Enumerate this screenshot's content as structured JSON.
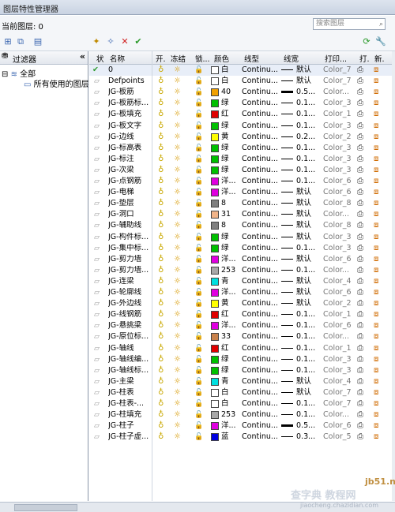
{
  "window": {
    "title": "图层特性管理器"
  },
  "current_layer": "当前图层: 0",
  "search": {
    "placeholder": "搜索图层"
  },
  "filter_tree": {
    "header": "过滤器",
    "collapse": "«",
    "nodes": [
      "全部",
      "所有使用的图层"
    ]
  },
  "columns": [
    "状",
    "名称",
    "开.",
    "冻结",
    "锁...",
    "颜色",
    "线型",
    "线宽",
    "打印...",
    "打.",
    "新."
  ],
  "rows": [
    {
      "name": "0",
      "color": "#ffffff",
      "cname": "白",
      "linetype": "Continu...",
      "lw": "默认",
      "thick": false,
      "plot": "Color_7",
      "current": true
    },
    {
      "name": "Defpoints",
      "color": "#ffffff",
      "cname": "白",
      "linetype": "Continu...",
      "lw": "默认",
      "thick": false,
      "plot": "Color_7"
    },
    {
      "name": "JG-板筋",
      "color": "#f0a000",
      "cname": "40",
      "linetype": "Continu...",
      "lw": "0.5...",
      "thick": true,
      "plot": "Color..."
    },
    {
      "name": "JG-板筋标...",
      "color": "#00c000",
      "cname": "绿",
      "linetype": "Continu...",
      "lw": "0.1...",
      "thick": false,
      "plot": "Color_3"
    },
    {
      "name": "JG-板填充",
      "color": "#e00000",
      "cname": "红",
      "linetype": "Continu...",
      "lw": "0.1...",
      "thick": false,
      "plot": "Color_1"
    },
    {
      "name": "JG-板文字",
      "color": "#00c000",
      "cname": "绿",
      "linetype": "Continu...",
      "lw": "0.1...",
      "thick": false,
      "plot": "Color_3"
    },
    {
      "name": "JG-边线",
      "color": "#ffff00",
      "cname": "黄",
      "linetype": "Continu...",
      "lw": "0.2...",
      "thick": false,
      "plot": "Color_2"
    },
    {
      "name": "JG-标高表",
      "color": "#00c000",
      "cname": "绿",
      "linetype": "Continu...",
      "lw": "0.1...",
      "thick": false,
      "plot": "Color_3"
    },
    {
      "name": "JG-标注",
      "color": "#00c000",
      "cname": "绿",
      "linetype": "Continu...",
      "lw": "0.1...",
      "thick": false,
      "plot": "Color_3"
    },
    {
      "name": "JG-次梁",
      "color": "#00c000",
      "cname": "绿",
      "linetype": "Continu...",
      "lw": "0.1...",
      "thick": false,
      "plot": "Color_3"
    },
    {
      "name": "JG-点钢筋",
      "color": "#e000e0",
      "cname": "洋...",
      "linetype": "Continu...",
      "lw": "0.1...",
      "thick": false,
      "plot": "Color_6"
    },
    {
      "name": "JG-电梯",
      "color": "#e000e0",
      "cname": "洋...",
      "linetype": "Continu...",
      "lw": "默认",
      "thick": false,
      "plot": "Color_6"
    },
    {
      "name": "JG-垫层",
      "color": "#808080",
      "cname": "8",
      "linetype": "Continu...",
      "lw": "默认",
      "thick": false,
      "plot": "Color_8"
    },
    {
      "name": "JG-洞口",
      "color": "#f2b58a",
      "cname": "31",
      "linetype": "Continu...",
      "lw": "默认",
      "thick": false,
      "plot": "Color..."
    },
    {
      "name": "JG-辅助线",
      "color": "#808080",
      "cname": "8",
      "linetype": "Continu...",
      "lw": "默认",
      "thick": false,
      "plot": "Color_8"
    },
    {
      "name": "JG-构件标...",
      "color": "#00c000",
      "cname": "绿",
      "linetype": "Continu...",
      "lw": "默认",
      "thick": false,
      "plot": "Color_3"
    },
    {
      "name": "JG-集中标...",
      "color": "#00c000",
      "cname": "绿",
      "linetype": "Continu...",
      "lw": "0.1...",
      "thick": false,
      "plot": "Color_3"
    },
    {
      "name": "JG-剪力墙",
      "color": "#e000e0",
      "cname": "洋...",
      "linetype": "Continu...",
      "lw": "默认",
      "thick": false,
      "plot": "Color_6"
    },
    {
      "name": "JG-剪力墙...",
      "color": "#a8a8a8",
      "cname": "253",
      "linetype": "Continu...",
      "lw": "0.1...",
      "thick": false,
      "plot": "Color..."
    },
    {
      "name": "JG-连梁",
      "color": "#00e0e0",
      "cname": "青",
      "linetype": "Continu...",
      "lw": "默认",
      "thick": false,
      "plot": "Color_4"
    },
    {
      "name": "JG-轮廓线",
      "color": "#e000e0",
      "cname": "洋...",
      "linetype": "Continu...",
      "lw": "默认",
      "thick": false,
      "plot": "Color_6"
    },
    {
      "name": "JG-外边线",
      "color": "#ffff00",
      "cname": "黄",
      "linetype": "Continu...",
      "lw": "默认",
      "thick": false,
      "plot": "Color_2"
    },
    {
      "name": "JG-线钢筋",
      "color": "#e00000",
      "cname": "红",
      "linetype": "Continu...",
      "lw": "0.1...",
      "thick": false,
      "plot": "Color_1"
    },
    {
      "name": "JG-悬挑梁",
      "color": "#e000e0",
      "cname": "洋...",
      "linetype": "Continu...",
      "lw": "0.1...",
      "thick": false,
      "plot": "Color_6"
    },
    {
      "name": "JG-原位标...",
      "color": "#c9824c",
      "cname": "33",
      "linetype": "Continu...",
      "lw": "0.1...",
      "thick": false,
      "plot": "Color..."
    },
    {
      "name": "JG-轴线",
      "color": "#e00000",
      "cname": "红",
      "linetype": "Continu...",
      "lw": "0.1...",
      "thick": false,
      "plot": "Color_1"
    },
    {
      "name": "JG-轴线编...",
      "color": "#00c000",
      "cname": "绿",
      "linetype": "Continu...",
      "lw": "0.1...",
      "thick": false,
      "plot": "Color_3"
    },
    {
      "name": "JG-轴线标...",
      "color": "#00c000",
      "cname": "绿",
      "linetype": "Continu...",
      "lw": "0.1...",
      "thick": false,
      "plot": "Color_3"
    },
    {
      "name": "JG-主梁",
      "color": "#00e0e0",
      "cname": "青",
      "linetype": "Continu...",
      "lw": "默认",
      "thick": false,
      "plot": "Color_4"
    },
    {
      "name": "JG-柱表",
      "color": "#ffffff",
      "cname": "白",
      "linetype": "Continu...",
      "lw": "默认",
      "thick": false,
      "plot": "Color_7"
    },
    {
      "name": "JG-柱表-...",
      "color": "#ffffff",
      "cname": "白",
      "linetype": "Continu...",
      "lw": "0.1...",
      "thick": false,
      "plot": "Color_7"
    },
    {
      "name": "JG-柱填充",
      "color": "#a8a8a8",
      "cname": "253",
      "linetype": "Continu...",
      "lw": "0.1...",
      "thick": false,
      "plot": "Color..."
    },
    {
      "name": "JG-柱子",
      "color": "#e000e0",
      "cname": "洋...",
      "linetype": "Continu...",
      "lw": "0.5...",
      "thick": true,
      "plot": "Color_6"
    },
    {
      "name": "JG-柱子虚...",
      "color": "#0000e0",
      "cname": "蓝",
      "linetype": "Continu...",
      "lw": "0.3...",
      "thick": false,
      "plot": "Color_5"
    }
  ],
  "watermark": {
    "site": "jb51.net",
    "brand": "查字典 教程网",
    "url": "jiaocheng.chazidian.com"
  }
}
